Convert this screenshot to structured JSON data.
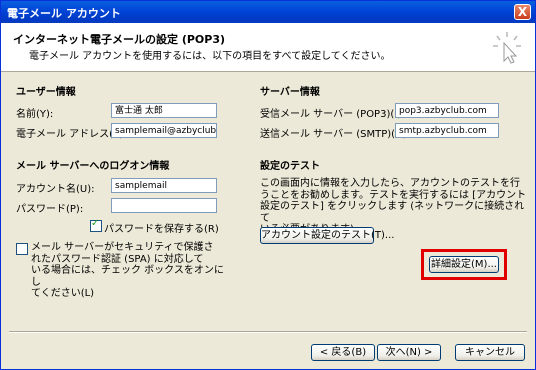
{
  "window": {
    "title": "電子メール アカウント",
    "close_glyph": "X"
  },
  "header": {
    "title": "インターネット電子メールの設定 (POP3)",
    "subtitle": "電子メール アカウントを使用するには、以下の項目をすべて設定してください。"
  },
  "user_info": {
    "heading": "ユーザー情報",
    "name_label": "名前(Y):",
    "name_value": "富士通 太郎",
    "email_label": "電子メール アドレス(E):",
    "email_value": "samplemail@azbyclub.cor"
  },
  "server_info": {
    "heading": "サーバー情報",
    "incoming_label": "受信メール サーバー (POP3)(I):",
    "incoming_value": "pop3.azbyclub.com",
    "outgoing_label": "送信メール サーバー (SMTP)(O):",
    "outgoing_value": "smtp.azbyclub.com"
  },
  "logon": {
    "heading": "メール サーバーへのログオン情報",
    "account_label": "アカウント名(U):",
    "account_value": "samplemail",
    "password_label": "パスワード(P):",
    "password_value": "",
    "save_password_label": "パスワードを保存する(R)",
    "save_password_checked": true,
    "spa_label": "メール サーバーがセキュリティで保護された パスワード認証 (SPA) に対応している場合には、チェック ボックスをオンにしてください(L)",
    "spa_line1": "メール サーバーがセキュリティで保護さ",
    "spa_line2": "れたパスワード認証 (SPA) に対応して",
    "spa_line3": "いる場合には、チェック ボックスをオンにし",
    "spa_line4": "てください(L)",
    "spa_checked": false
  },
  "test": {
    "heading": "設定のテスト",
    "desc_line1": "この画面内に情報を入力したら、アカウントのテストを行",
    "desc_line2": "うことをお勧めします。テストを実行するには [アカウント",
    "desc_line3": "設定のテスト] をクリックします (ネットワークに接続されて",
    "desc_line4": "いる必要があります)。",
    "test_button": "アカウント設定のテスト(T)...",
    "advanced_button": "詳細設定(M)..."
  },
  "footer": {
    "back_button": "< 戻る(B)",
    "next_button": "次へ(N) >",
    "cancel_button": "キャンセル"
  },
  "colors": {
    "highlight": "#e00000",
    "titlebar": "#0145d6",
    "dialog_bg": "#ece9d8"
  },
  "icons": {
    "wizard": "cursor-sparkle-icon",
    "close": "close-icon"
  }
}
